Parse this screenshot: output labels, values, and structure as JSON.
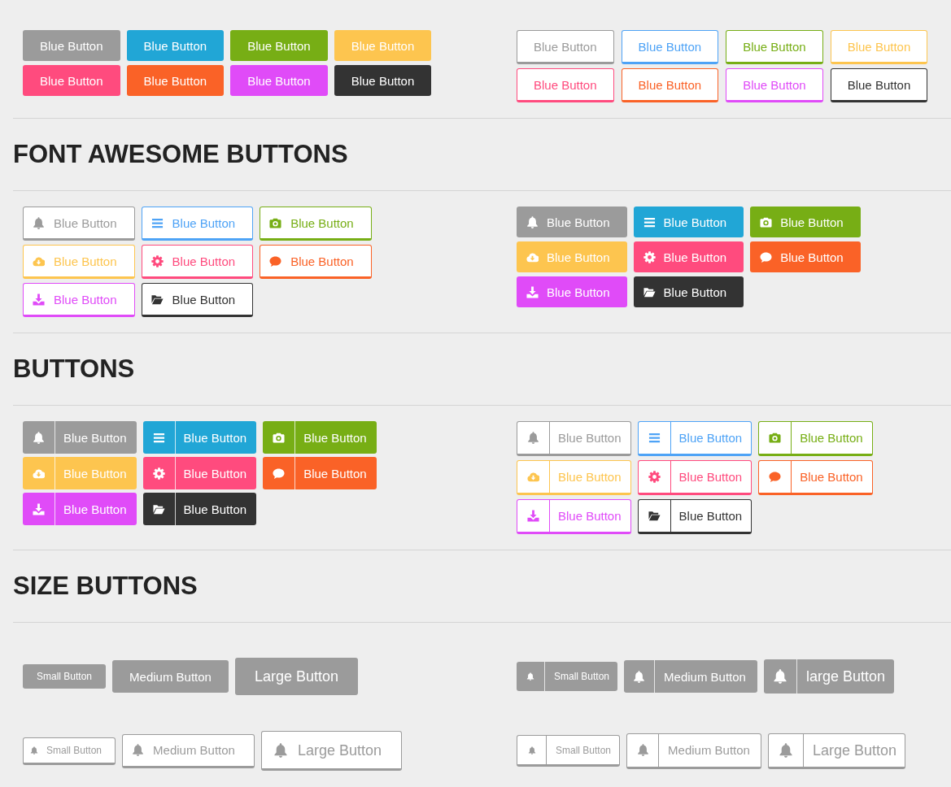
{
  "sections": [
    {
      "groups": [
        {
          "kind": "solid",
          "rows": [
            [
              {
                "label": "Blue Button",
                "color": "#9b9b9b"
              },
              {
                "label": "Blue Button",
                "color": "#21a6d6"
              },
              {
                "label": "Blue Button",
                "color": "#77ae15"
              },
              {
                "label": "Blue Button",
                "color": "#fdc54f"
              }
            ],
            [
              {
                "label": "Blue Button",
                "color": "#ff4b7e"
              },
              {
                "label": "Blue Button",
                "color": "#fa6227"
              },
              {
                "label": "Blue Button",
                "color": "#e04bf8"
              },
              {
                "label": "Blue Button",
                "color": "#333333"
              }
            ]
          ]
        },
        {
          "kind": "outline",
          "rows": [
            [
              {
                "label": "Blue Button",
                "color": "#9b9b9b"
              },
              {
                "label": "Blue Button",
                "color": "#4ea3f6"
              },
              {
                "label": "Blue Button",
                "color": "#77ae15"
              },
              {
                "label": "Blue Button",
                "color": "#fdc54f"
              }
            ],
            [
              {
                "label": "Blue Button",
                "color": "#ff4b7e"
              },
              {
                "label": "Blue Button",
                "color": "#fa6227"
              },
              {
                "label": "Blue Button",
                "color": "#e04bf8"
              },
              {
                "label": "Blue Button",
                "color": "#333333"
              }
            ]
          ]
        }
      ]
    },
    {
      "heading": "FONT AWESOME BUTTONS",
      "groups": [
        {
          "kind": "outline-icon",
          "rows": [
            [
              {
                "label": "Blue Button",
                "color": "#9b9b9b"
              },
              {
                "label": "Blue Button",
                "color": "#4ea3f6"
              },
              {
                "label": "Blue Button",
                "color": "#77ae15"
              }
            ],
            [
              {
                "label": "Blue Button",
                "color": "#fdc54f"
              },
              {
                "label": "Blue Button",
                "color": "#ff4b7e"
              },
              {
                "label": "Blue Button",
                "color": "#fa6227"
              }
            ],
            [
              {
                "label": "Blue Button",
                "color": "#e04bf8"
              },
              {
                "label": "Blue Button",
                "color": "#333333"
              }
            ]
          ]
        },
        {
          "kind": "solid-icon",
          "rows": [
            [
              {
                "label": "Blue Button",
                "color": "#9b9b9b"
              },
              {
                "label": "Blue Button",
                "color": "#21a6d6"
              },
              {
                "label": "Blue Button",
                "color": "#77ae15"
              }
            ],
            [
              {
                "label": "Blue Button",
                "color": "#fdc54f"
              },
              {
                "label": "Blue Button",
                "color": "#ff4b7e"
              },
              {
                "label": "Blue Button",
                "color": "#fa6227"
              }
            ],
            [
              {
                "label": "Blue Button",
                "color": "#e04bf8"
              },
              {
                "label": "Blue Button",
                "color": "#333333"
              }
            ]
          ]
        }
      ]
    },
    {
      "heading": "BUTTONS",
      "groups": [
        {
          "kind": "solid-split",
          "rows": [
            [
              {
                "label": "Blue Button",
                "color": "#9b9b9b"
              },
              {
                "label": "Blue Button",
                "color": "#21a6d6"
              },
              {
                "label": "Blue Button",
                "color": "#77ae15"
              }
            ],
            [
              {
                "label": "Blue Button",
                "color": "#fdc54f"
              },
              {
                "label": "Blue Button",
                "color": "#ff4b7e"
              },
              {
                "label": "Blue Button",
                "color": "#fa6227"
              }
            ],
            [
              {
                "label": "Blue Button",
                "color": "#e04bf8"
              },
              {
                "label": "Blue Button",
                "color": "#333333"
              }
            ]
          ]
        },
        {
          "kind": "outline-split",
          "rows": [
            [
              {
                "label": "Blue Button",
                "color": "#9b9b9b"
              },
              {
                "label": "Blue Button",
                "color": "#4ea3f6"
              },
              {
                "label": "Blue Button",
                "color": "#77ae15"
              }
            ],
            [
              {
                "label": "Blue Button",
                "color": "#fdc54f"
              },
              {
                "label": "Blue Button",
                "color": "#ff4b7e"
              },
              {
                "label": "Blue Button",
                "color": "#fa6227"
              }
            ],
            [
              {
                "label": "Blue Button",
                "color": "#e04bf8"
              },
              {
                "label": "Blue Button",
                "color": "#333333"
              }
            ]
          ]
        }
      ]
    },
    {
      "heading": "SIZE BUTTONS",
      "groups": [
        {
          "kind": "solid",
          "rows": [
            [
              {
                "label": "Small Button",
                "kind": "small",
                "color": "#9b9b9b"
              },
              {
                "label": "Medium Button",
                "kind": "medium",
                "color": "#9b9b9b"
              },
              {
                "label": "Large Button",
                "kind": "large",
                "color": "#9b9b9b"
              }
            ]
          ]
        },
        {
          "kind": "solid-split",
          "rows": [
            [
              {
                "label": "Small Button",
                "kind": "small",
                "color": "#9b9b9b"
              },
              {
                "label": "Medium Button",
                "kind": "medium",
                "color": "#9b9b9b"
              },
              {
                "label": "large Button",
                "kind": "large",
                "color": "#9b9b9b"
              }
            ]
          ]
        },
        {
          "kind": "outline-icon",
          "rows": [
            [
              {
                "label": "Small Button",
                "kind": "small",
                "color": "#9b9b9b"
              },
              {
                "label": "Medium Button",
                "kind": "medium",
                "color": "#9b9b9b"
              },
              {
                "label": "Large Button",
                "kind": "large",
                "color": "#9b9b9b"
              }
            ]
          ]
        },
        {
          "kind": "outline-split",
          "rows": [
            [
              {
                "label": "Small Button",
                "kind": "small",
                "color": "#9b9b9b"
              },
              {
                "label": "Medium Button",
                "kind": "medium",
                "color": "#9b9b9b"
              },
              {
                "label": "Large Button",
                "kind": "large",
                "color": "#9b9b9b"
              }
            ]
          ]
        }
      ]
    }
  ]
}
